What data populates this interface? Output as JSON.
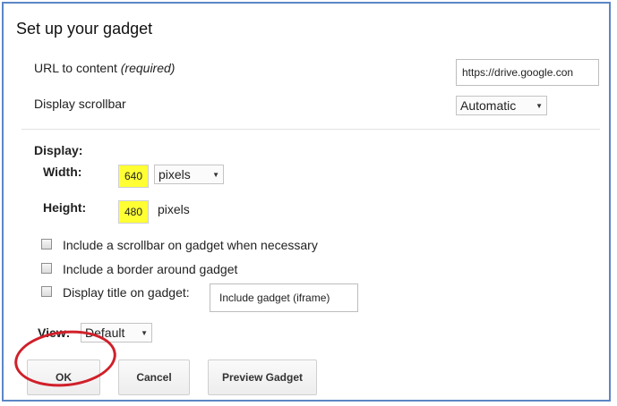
{
  "dialog": {
    "title": "Set up your gadget",
    "url_label": "URL to content",
    "url_required_note": "(required)",
    "url_value": "https://drive.google.con",
    "scrollbar_label": "Display scrollbar",
    "scrollbar_value": "Automatic"
  },
  "display": {
    "section_label": "Display:",
    "width_label": "Width:",
    "width_value": "640",
    "width_unit": "pixels",
    "height_label": "Height:",
    "height_value": "480",
    "height_unit": "pixels",
    "options": [
      {
        "label": "Include a scrollbar on gadget when necessary",
        "checked": false
      },
      {
        "label": "Include a border around gadget",
        "checked": false
      },
      {
        "label": "Display title on gadget:",
        "checked": false
      }
    ],
    "title_value": "Include gadget (iframe)",
    "view_label": "View:",
    "view_value": "Default"
  },
  "buttons": {
    "ok": "OK",
    "cancel": "Cancel",
    "preview": "Preview Gadget"
  },
  "annotation_color": "#d0202a",
  "highlight_color": "#ffff33"
}
